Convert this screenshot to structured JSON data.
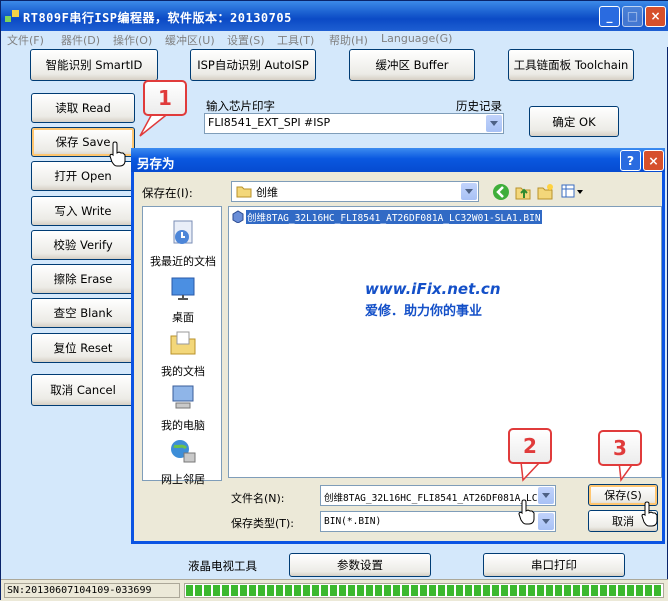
{
  "window": {
    "title": "RT809F串行ISP编程器，软件版本：20130705"
  },
  "menu": [
    "文件(F)",
    "器件(D)",
    "操作(O)",
    "缓冲区(U)",
    "设置(S)",
    "工具(T)",
    "帮助(H)",
    "Language(G)"
  ],
  "toolbar": {
    "smart_id": "智能识别 SmartID",
    "isp_auto": "ISP自动识别 AutoISP",
    "buffer": "缓冲区 Buffer",
    "toolchain": "工具链面板 Toolchain"
  },
  "side_buttons": [
    "读取 Read",
    "保存 Save",
    "打开 Open",
    "写入 Write",
    "校验 Verify",
    "擦除 Erase",
    "查空 Blank",
    "复位 Reset",
    "取消 Cancel"
  ],
  "chip": {
    "label": "输入芯片印字",
    "history_label": "历史记录",
    "value": "FLI8541_EXT_SPI #ISP",
    "ok_button": "确定 OK"
  },
  "bottom_tools": {
    "lcd_tool": "液晶电视工具",
    "param_button": "参数设置",
    "serial_button": "串口打印"
  },
  "status": {
    "sn": "SN:20130607104109-033699",
    "progress": 1.0
  },
  "dialog": {
    "title": "另存为",
    "save_in_label": "保存在(I):",
    "save_in_value": "创维",
    "places": [
      "我最近的文档",
      "桌面",
      "我的文档",
      "我的电脑",
      "网上邻居"
    ],
    "file_item": "创维8TAG_32L16HC_FLI8541_AT26DF081A_LC32W01-SLA1.BIN",
    "filename_label": "文件名(N):",
    "filename_value": "创维8TAG_32L16HC_FLI8541_AT26DF081A_LC",
    "filetype_label": "保存类型(T):",
    "filetype_value": "BIN(*.BIN)",
    "save_button": "保存(S)",
    "cancel_button": "取消",
    "watermark_url": "www.iFix.net.cn",
    "watermark_slogan": "爱修．助力你的事业"
  },
  "badges": [
    "1",
    "2",
    "3"
  ],
  "colors": {
    "accent_blue": "#0b54e3",
    "badge_red": "#e03b3b",
    "progress_green": "#3bb82e"
  }
}
